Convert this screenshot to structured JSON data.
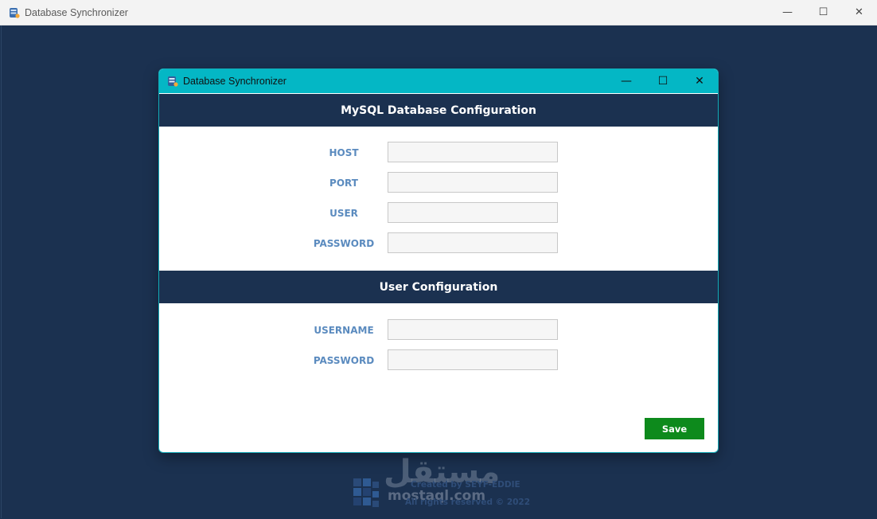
{
  "outer_window": {
    "title": "Database Synchronizer",
    "controls": {
      "minimize": "—",
      "maximize": "☐",
      "close": "✕"
    }
  },
  "dialog": {
    "title": "Database Synchronizer",
    "controls": {
      "minimize": "—",
      "maximize": "☐",
      "close": "✕"
    },
    "mysql_section": {
      "heading": "MySQL Database Configuration",
      "fields": [
        {
          "label": "HOST",
          "value": ""
        },
        {
          "label": "PORT",
          "value": ""
        },
        {
          "label": "USER",
          "value": ""
        },
        {
          "label": "PASSWORD",
          "value": ""
        }
      ]
    },
    "user_section": {
      "heading": "User Configuration",
      "fields": [
        {
          "label": "USERNAME",
          "value": ""
        },
        {
          "label": "PASSWORD",
          "value": ""
        }
      ]
    },
    "save_label": "Save"
  },
  "footer": {
    "created_by": "Created by SEYF-EDDIE",
    "rights": "All rights reserved © 2022",
    "watermark": "مستقل",
    "watermark_sub": "mostaql.com"
  },
  "colors": {
    "background": "#1b3150",
    "dialog_titlebar": "#04b7c5",
    "label": "#5b8bbf",
    "save_button": "#0d8a1c"
  }
}
